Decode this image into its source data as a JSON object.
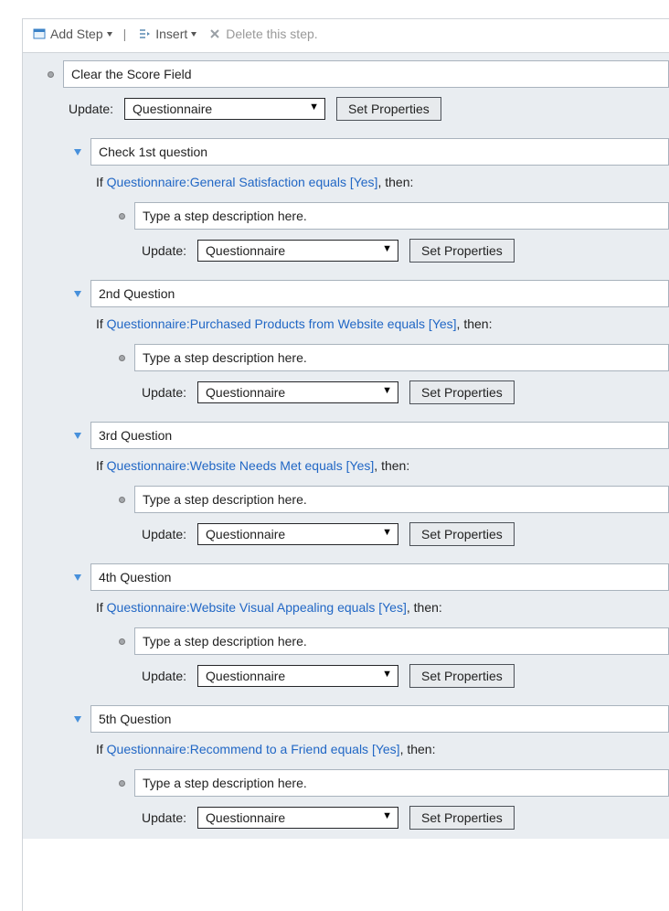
{
  "toolbar": {
    "add_step_label": "Add Step",
    "insert_label": "Insert",
    "delete_label": "Delete this step."
  },
  "common": {
    "update_label": "Update:",
    "entity_value": "Questionnaire",
    "set_properties_label": "Set Properties",
    "step_placeholder": "Type a step description here.",
    "if_prefix": "If ",
    "then_suffix": ", then:"
  },
  "root": {
    "description": "Clear the Score Field"
  },
  "questions": [
    {
      "title": "Check 1st question",
      "condition_link": "Questionnaire:General Satisfaction equals [Yes]"
    },
    {
      "title": "2nd Question",
      "condition_link": "Questionnaire:Purchased Products from Website equals [Yes]"
    },
    {
      "title": "3rd Question",
      "condition_link": "Questionnaire:Website Needs Met equals [Yes]"
    },
    {
      "title": "4th Question",
      "condition_link": "Questionnaire:Website Visual Appealing equals [Yes]"
    },
    {
      "title": "5th Question",
      "condition_link": "Questionnaire:Recommend to a Friend equals [Yes]"
    }
  ]
}
